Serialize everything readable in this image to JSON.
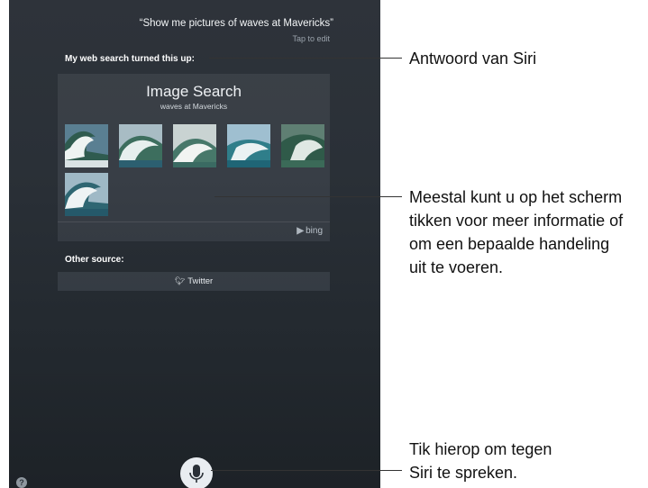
{
  "siri": {
    "query": "“Show me pictures of waves at Mavericks”",
    "tap_to_edit": "Tap to edit",
    "response_heading": "My web search turned this up:",
    "card": {
      "title": "Image Search",
      "subtitle": "waves at Mavericks",
      "image_count": 6,
      "provider": "bing"
    },
    "other_source_heading": "Other source:",
    "other_source_button": "Twitter"
  },
  "icons": {
    "mic": "microphone-icon",
    "help": "help-icon",
    "twitter": "twitter-bird-icon",
    "bing": "bing-logo-icon"
  },
  "help_glyph": "?",
  "callouts": {
    "answer": "Antwoord van Siri",
    "tap_more": [
      "Meestal kunt u op het scherm",
      "tikken voor meer informatie of",
      "om een bepaalde handeling",
      "uit te voeren."
    ],
    "speak": [
      "Tik hierop om tegen",
      "Siri te spreken."
    ]
  },
  "colors": {
    "screen_background": "#2a3037",
    "text_light": "#ffffff",
    "callout_text": "#111111"
  }
}
